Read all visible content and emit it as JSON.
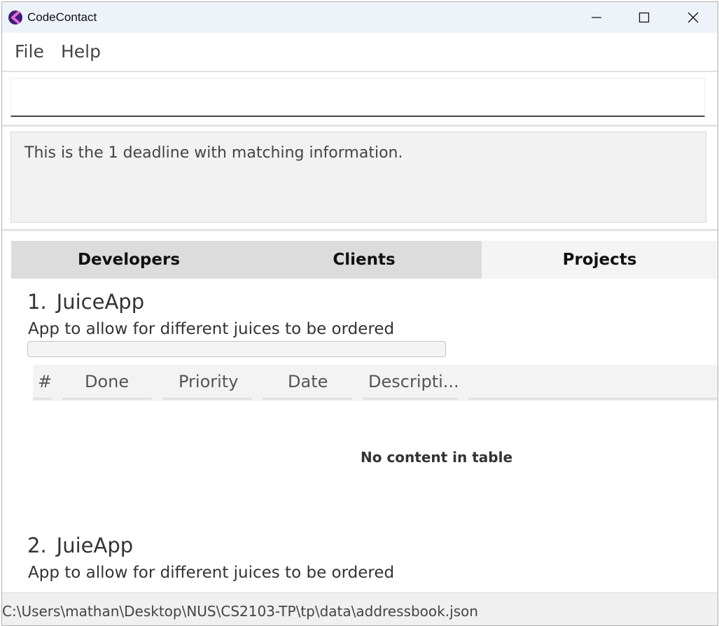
{
  "window": {
    "title": "CodeContact"
  },
  "menu": [
    "File",
    "Help"
  ],
  "command": {
    "value": "",
    "placeholder": ""
  },
  "result": {
    "message": "This is the 1 deadline with matching information."
  },
  "tabs": [
    {
      "label": "Developers",
      "active": false
    },
    {
      "label": "Clients",
      "active": false
    },
    {
      "label": "Projects",
      "active": true
    }
  ],
  "projects": [
    {
      "index": "1.",
      "name": "JuiceApp",
      "description": "App to allow for different juices to be ordered",
      "progress_percent": 0,
      "table": {
        "columns": [
          "#",
          "Done",
          "Priority",
          "Date",
          "Descripti..."
        ],
        "rows": [],
        "empty_message": "No content in table"
      }
    },
    {
      "index": "2.",
      "name": "JuieApp",
      "description": "App to allow for different juices to be ordered"
    }
  ],
  "status": {
    "file_path": "C:\\Users\\mathan\\Desktop\\NUS\\CS2103-TP\\tp\\data\\addressbook.json"
  },
  "colors": {
    "accent_logo": "#6b2fd6",
    "tab_inactive": "#dcdcdc",
    "tab_active": "#f4f4f4"
  }
}
